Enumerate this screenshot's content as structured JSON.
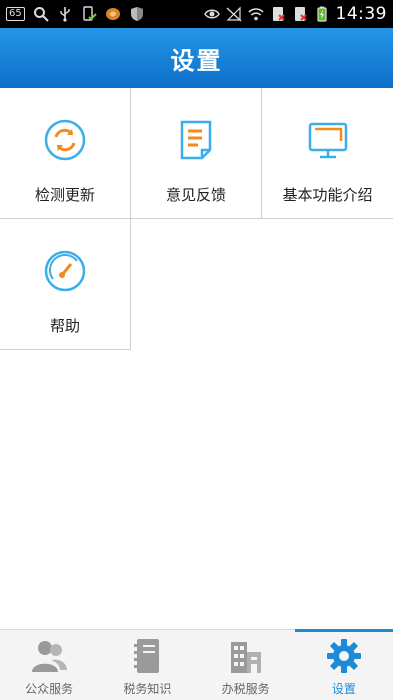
{
  "status_bar": {
    "badge": "65",
    "time": "14:39"
  },
  "header": {
    "title": "设置"
  },
  "grid": {
    "items": [
      {
        "label": "检测更新",
        "icon": "refresh-icon"
      },
      {
        "label": "意见反馈",
        "icon": "feedback-document-icon"
      },
      {
        "label": "基本功能介绍",
        "icon": "monitor-icon"
      },
      {
        "label": "帮助",
        "icon": "gauge-icon"
      }
    ]
  },
  "tabbar": {
    "tabs": [
      {
        "label": "公众服务",
        "icon": "users-icon",
        "active": false
      },
      {
        "label": "税务知识",
        "icon": "notebook-icon",
        "active": false
      },
      {
        "label": "办税服务",
        "icon": "building-icon",
        "active": false
      },
      {
        "label": "设置",
        "icon": "gear-icon",
        "active": true
      }
    ]
  },
  "colors": {
    "header": "#1b7fd6",
    "accent": "#1b8bd8",
    "icon_blue": "#3aaee8",
    "icon_orange": "#f28a1e"
  }
}
